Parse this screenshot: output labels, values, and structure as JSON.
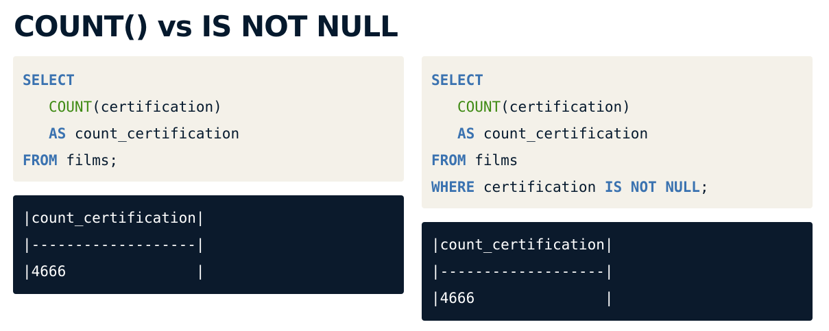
{
  "title": "COUNT() vs IS NOT NULL",
  "left": {
    "code": {
      "line1_kw": "SELECT",
      "line2_indent": "   ",
      "line2_fn": "COUNT",
      "line2_rest": "(certification)",
      "line3_indent": "   ",
      "line3_kw": "AS",
      "line3_rest": " count_certification",
      "line4_kw": "FROM",
      "line4_rest": " films;"
    },
    "output": {
      "header": "|count_certification|",
      "separator": "|-------------------|",
      "value_row": "|4666               |"
    }
  },
  "right": {
    "code": {
      "line1_kw": "SELECT",
      "line2_indent": "   ",
      "line2_fn": "COUNT",
      "line2_rest": "(certification)",
      "line3_indent": "   ",
      "line3_kw": "AS",
      "line3_rest": " count_certification",
      "line4_kw": "FROM",
      "line4_rest": " films",
      "line5_kw": "WHERE",
      "line5_mid": " certification ",
      "line5_kw2": "IS NOT NULL",
      "line5_end": ";"
    },
    "output": {
      "header": "|count_certification|",
      "separator": "|-------------------|",
      "value_row": "|4666               |"
    }
  },
  "colors": {
    "title": "#05192d",
    "code_background": "#f4f1e9",
    "keyword": "#3a72b0",
    "function": "#3e8a13",
    "output_background": "#0b1a2c",
    "output_text": "#ffffff"
  }
}
